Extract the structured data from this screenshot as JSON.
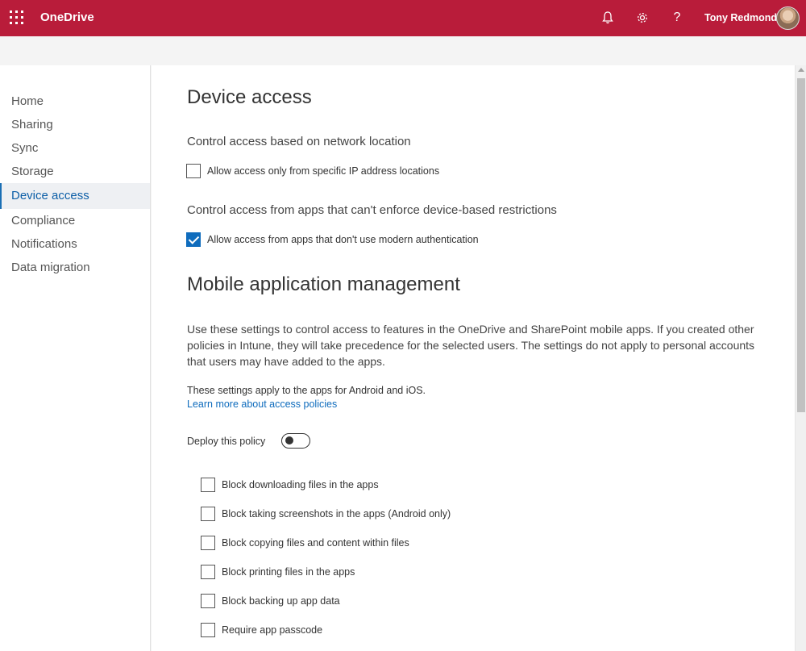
{
  "topbar": {
    "app_name": "OneDrive",
    "user_name": "Tony Redmond",
    "icons": [
      "waffle-icon",
      "bell-icon",
      "gear-icon",
      "help-icon"
    ],
    "brand_color": "#b91c3a"
  },
  "sidebar": {
    "items": [
      {
        "label": "Home",
        "active": false
      },
      {
        "label": "Sharing",
        "active": false
      },
      {
        "label": "Sync",
        "active": false
      },
      {
        "label": "Storage",
        "active": false
      },
      {
        "label": "Device access",
        "active": true
      },
      {
        "label": "Compliance",
        "active": false
      },
      {
        "label": "Notifications",
        "active": false
      },
      {
        "label": "Data migration",
        "active": false
      }
    ]
  },
  "main": {
    "title": "Device access",
    "network_heading": "Control access based on network location",
    "ip_checkbox": {
      "label": "Allow access only from specific IP address locations",
      "checked": false
    },
    "apps_heading": "Control access from apps that can't enforce device-based restrictions",
    "modern_auth_checkbox": {
      "label": "Allow access from apps that don't use modern authentication",
      "checked": true
    },
    "mam_title": "Mobile application management",
    "mam_description": "Use these settings to control access to features in the OneDrive and SharePoint mobile apps. If you created other policies in Intune, they will take precedence for the selected users. The settings do not apply to personal accounts that users may have added to the apps.",
    "platforms_note": "These settings apply to the apps for Android and iOS.",
    "learn_more_link": "Learn more about access policies",
    "deploy_label": "Deploy this policy",
    "deploy_on": false,
    "policy_checkboxes": [
      {
        "label": "Block downloading files in the apps",
        "checked": false
      },
      {
        "label": "Block taking screenshots in the apps (Android only)",
        "checked": false
      },
      {
        "label": "Block copying files and content within files",
        "checked": false
      },
      {
        "label": "Block printing files in the apps",
        "checked": false
      },
      {
        "label": "Block backing up app data",
        "checked": false
      },
      {
        "label": "Require app passcode",
        "checked": false
      }
    ],
    "accent_color": "#0f6cbd"
  }
}
